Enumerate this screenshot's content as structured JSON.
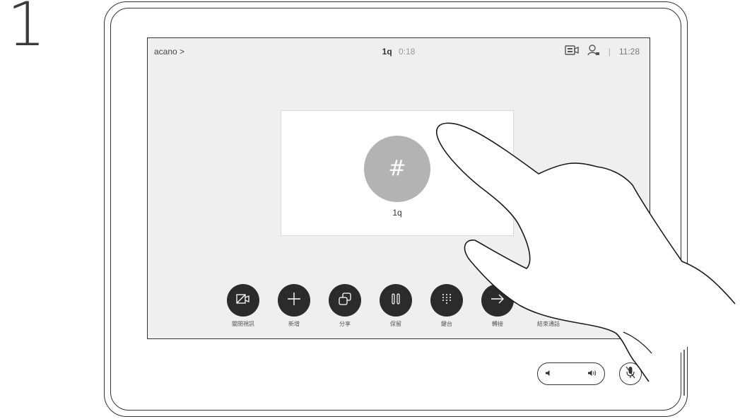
{
  "step": {
    "number": "1"
  },
  "status_bar": {
    "left_label": "acano >",
    "call_name": "1q",
    "call_timer": "0:18",
    "clock": "11:28",
    "separator": "|",
    "icons": [
      "self-view-icon",
      "participants-icon"
    ]
  },
  "video_tile": {
    "avatar_symbol": "#",
    "name": "1q"
  },
  "controls": [
    {
      "label": "關閉視訊",
      "icon": "camera-off-icon"
    },
    {
      "label": "新增",
      "icon": "plus-icon"
    },
    {
      "label": "分享",
      "icon": "share-icon"
    },
    {
      "label": "保留",
      "icon": "pause-icon"
    },
    {
      "label": "鍵台",
      "icon": "keypad-icon"
    },
    {
      "label": "轉接",
      "icon": "arrow-right-icon"
    },
    {
      "label": "結束通話",
      "icon": "end-call-icon"
    }
  ],
  "hardware": {
    "volume_icons": [
      "volume-down-icon",
      "volume-up-icon"
    ],
    "mic_icon": "microphone-mute-icon"
  }
}
